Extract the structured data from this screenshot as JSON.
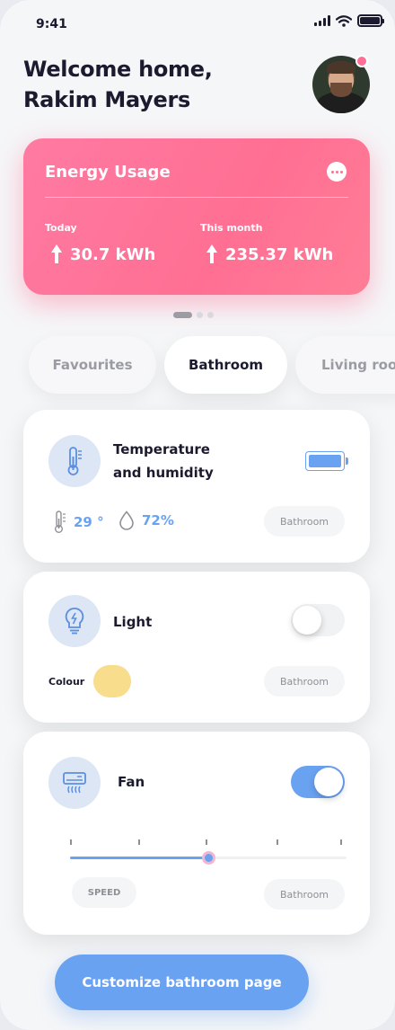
{
  "status_bar": {
    "time": "9:41"
  },
  "header": {
    "welcome": "Welcome home, Rakim Mayers"
  },
  "energy": {
    "title": "Energy Usage",
    "today_label": "Today",
    "today_value": "30.7 kWh",
    "month_label": "This month",
    "month_value": "235.37 kWh"
  },
  "tabs": [
    {
      "label": "Favourites",
      "active": false
    },
    {
      "label": "Bathroom",
      "active": true
    },
    {
      "label": "Living room",
      "active": false
    }
  ],
  "temperature_card": {
    "title_line1": "Temperature",
    "title_line2": "and humidity",
    "temperature": "29 °",
    "humidity": "72%",
    "room": "Bathroom",
    "battery_level": 1.0
  },
  "light_card": {
    "title": "Light",
    "toggle_on": false,
    "colour_label": "Colour",
    "colour": "#f7dd8c",
    "room": "Bathroom"
  },
  "fan_card": {
    "title": "Fan",
    "toggle_on": true,
    "speed_label": "SPEED",
    "speed_fraction": 0.5,
    "room": "Bathroom"
  },
  "cta": {
    "label": "Customize bathroom page"
  },
  "colors": {
    "accent_blue": "#6aa2f2",
    "energy_pink": "#ff6f93",
    "light_yellow": "#f7dd8c"
  }
}
